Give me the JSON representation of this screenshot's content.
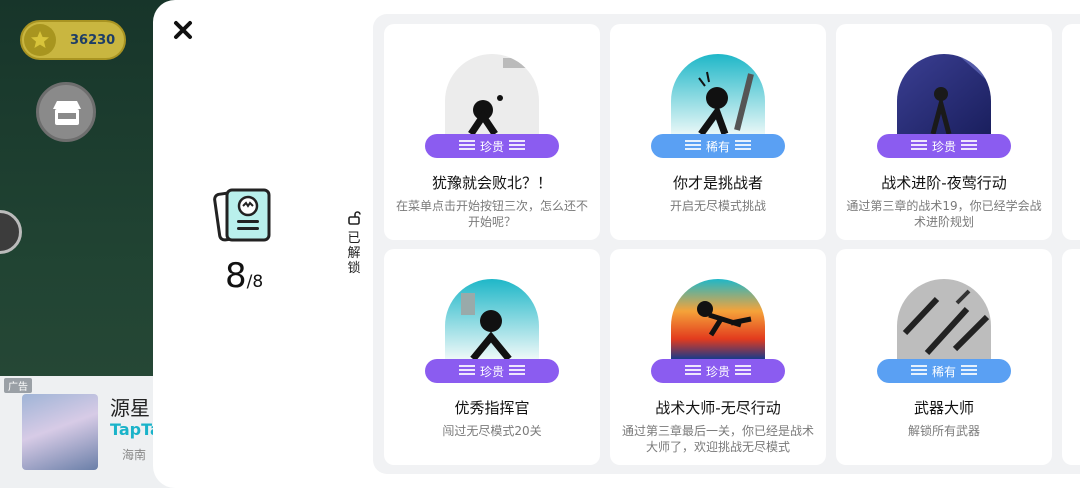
{
  "background": {
    "coins": "36230",
    "ad": {
      "tag": "广告",
      "title": "源星",
      "brand": "TapTap",
      "subtitle": "海南"
    }
  },
  "modal": {
    "unlocked_count": "8",
    "unlocked_total": "/8",
    "tab_label": "已解锁",
    "achievements": [
      {
        "title": "犹豫就会败北？！",
        "desc": "在菜单点击开始按钮三次，怎么还不开始呢？",
        "rarity": "珍贵",
        "rarity_color": "#8b5cf0"
      },
      {
        "title": "你才是挑战者",
        "desc": "开启无尽模式挑战",
        "rarity": "稀有",
        "rarity_color": "#5aa0f3"
      },
      {
        "title": "战术进阶-夜莺行动",
        "desc": "通过第三章的战术19，你已经学会战术进阶规划",
        "rarity": "珍贵",
        "rarity_color": "#8b5cf0"
      },
      {
        "title": "优秀指挥官",
        "desc": "闯过无尽模式20关",
        "rarity": "珍贵",
        "rarity_color": "#8b5cf0"
      },
      {
        "title": "战术大师-无尽行动",
        "desc": "通过第三章最后一关，你已经是战术大师了，欢迎挑战无尽模式",
        "rarity": "珍贵",
        "rarity_color": "#8b5cf0"
      },
      {
        "title": "武器大师",
        "desc": "解锁所有武器",
        "rarity": "稀有",
        "rarity_color": "#5aa0f3"
      }
    ]
  }
}
